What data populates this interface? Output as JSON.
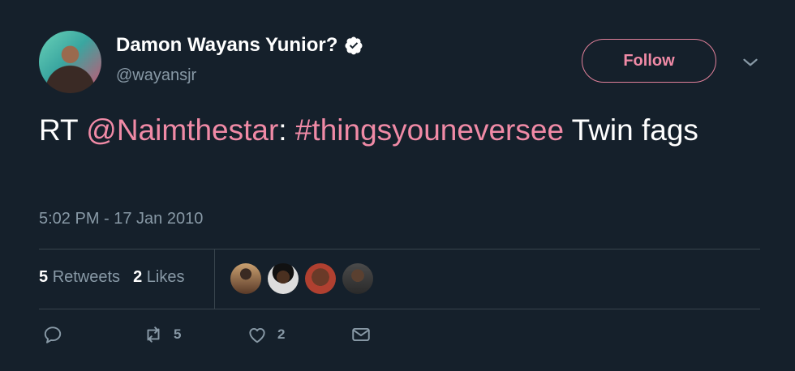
{
  "author": {
    "name": "Damon Wayans Yunior?",
    "handle": "@wayansjr",
    "verified": true
  },
  "follow_label": "Follow",
  "tweet": {
    "prefix": "RT ",
    "mention": "@Naimthestar",
    "colon": ": ",
    "hashtag": "#thingsyouneversee",
    "rest": " Twin fags"
  },
  "timestamp": "5:02 PM - 17 Jan 2010",
  "stats": {
    "retweets_count": "5",
    "retweets_label": "Retweets",
    "likes_count": "2",
    "likes_label": "Likes"
  },
  "likers": [
    "liker-1",
    "liker-2",
    "liker-3",
    "liker-4"
  ],
  "actions": {
    "reply_icon": "reply-icon",
    "retweet_icon": "retweet-icon",
    "retweet_count": "5",
    "like_icon": "heart-icon",
    "like_count": "2",
    "dm_icon": "envelope-icon"
  },
  "colors": {
    "background": "#15202b",
    "accent": "#f08aa6",
    "muted": "#8899a6",
    "divider": "#38444d"
  }
}
